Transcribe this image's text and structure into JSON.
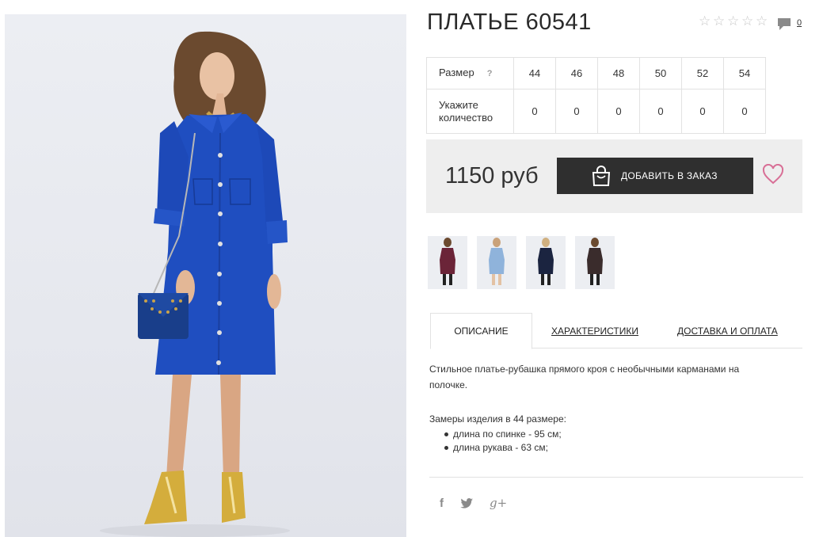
{
  "product": {
    "title": "ПЛАТЬЕ 60541",
    "rating_icons": [
      "star-outline",
      "star-outline",
      "star-outline",
      "star-outline",
      "star-outline"
    ],
    "comments_count": "0"
  },
  "sizes": {
    "size_label": "Размер",
    "help_mark": "?",
    "qty_label_line1": "Укажите",
    "qty_label_line2": "количество",
    "values": [
      "44",
      "46",
      "48",
      "50",
      "52",
      "54"
    ],
    "quantities": [
      "0",
      "0",
      "0",
      "0",
      "0",
      "0"
    ]
  },
  "purchase": {
    "price": "1150 руб",
    "add_button_label": "ДОБАВИТЬ В ЗАКАЗ",
    "accent_color": "#d86f96",
    "button_color": "#2f2f2f"
  },
  "thumbnails": [
    {
      "color": "#6b2438",
      "name": "burgundy"
    },
    {
      "color": "#8fb3db",
      "name": "light-blue"
    },
    {
      "color": "#1b2440",
      "name": "navy"
    },
    {
      "color": "#3a2c2c",
      "name": "dark-brown"
    }
  ],
  "tabs": {
    "description": "ОПИСАНИЕ",
    "characteristics": "ХАРАКТЕРИСТИКИ",
    "delivery": "ДОСТАВКА И ОПЛАТА"
  },
  "description": {
    "text": "Стильное платье-рубашка прямого кроя с необычными карманами на полочке.",
    "measures_title": "Замеры изделия в 44 размере:",
    "measures": [
      "длина по спинке - 95 см;",
      "длина рукава - 63 см;"
    ]
  },
  "social": {
    "facebook": "f",
    "twitter": "twitter-icon",
    "gplus": "g+"
  }
}
